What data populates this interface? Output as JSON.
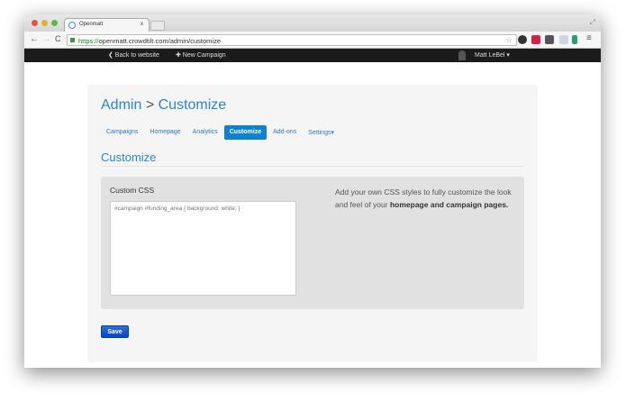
{
  "browser": {
    "tab_title": "Openmatt",
    "tab_close": "x",
    "url_scheme": "https://",
    "url_rest": "openmatt.crowdtilt.com/admin/customize"
  },
  "topnav": {
    "back": "❮ Back to website",
    "new_campaign": "✚ New Campaign",
    "user": "Matt LeBel ▾"
  },
  "page": {
    "title_admin": "Admin",
    "title_sep": ">",
    "title_page": "Customize",
    "tabs": [
      {
        "label": "Campaigns"
      },
      {
        "label": "Homepage"
      },
      {
        "label": "Analytics"
      },
      {
        "label": "Customize",
        "active": true
      },
      {
        "label": "Add-ons"
      },
      {
        "label": "Settings▾"
      }
    ],
    "section_title": "Customize",
    "css_label": "Custom CSS",
    "css_placeholder": "#campaign #funding_area { background: white; }",
    "help_text": "Add your own CSS styles to fully customize the look and feel of your ",
    "help_bold": "homepage and campaign pages.",
    "save_label": "Save"
  },
  "colors": {
    "accent": "#2a86d0",
    "active_tab": "#0e82cf",
    "topnav": "#1b1b1b"
  }
}
